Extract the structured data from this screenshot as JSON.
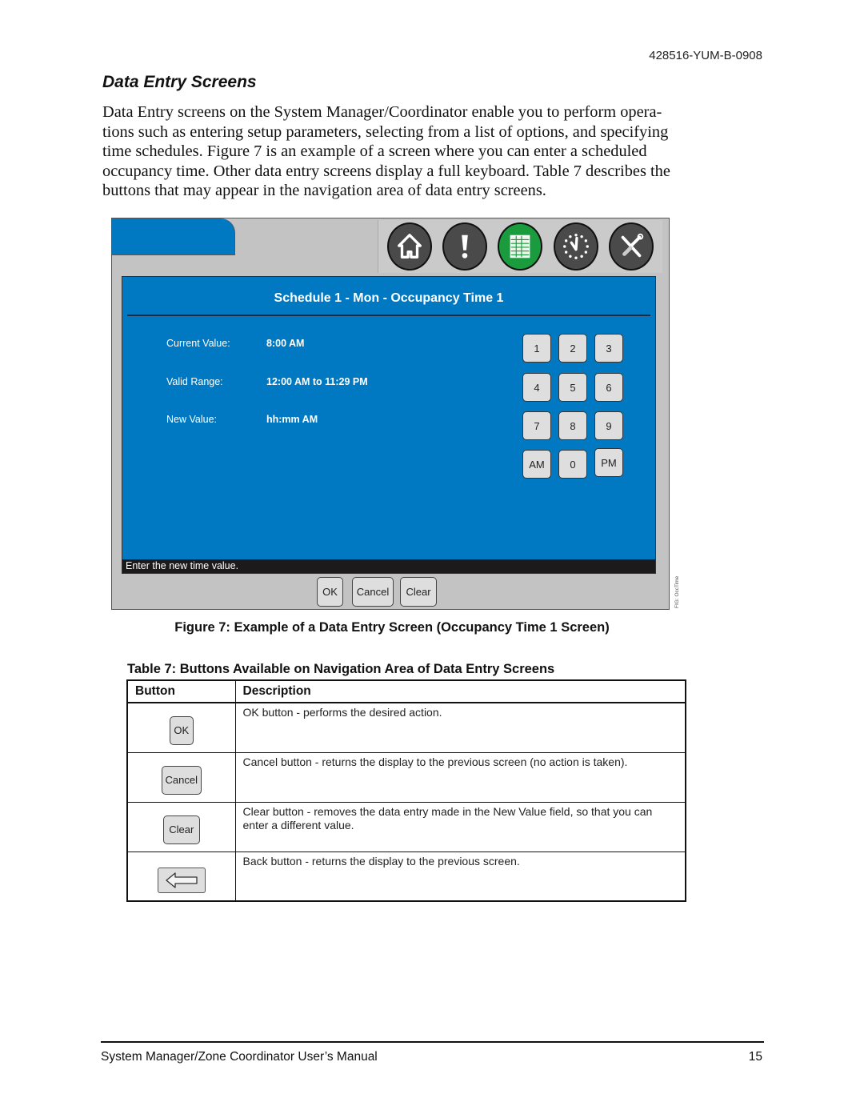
{
  "header": {
    "doc_id": "428516-YUM-B-0908"
  },
  "section": {
    "title": "Data Entry Screens",
    "body": "Data Entry screens on the System Manager/Coordinator enable you to perform opera-tions such as entering setup parameters, selecting from a list of options, and specifying time schedules. Figure 7 is an example of a screen where you can enter a scheduled occupancy time. Other data entry screens display a full keyboard. Table 7 describes the buttons that may appear in the navigation area of data entry screens."
  },
  "screen": {
    "nav_icons": [
      {
        "name": "home-icon",
        "active": false
      },
      {
        "name": "alarm-icon",
        "active": false
      },
      {
        "name": "schedule-icon",
        "active": true
      },
      {
        "name": "clock-icon",
        "active": false
      },
      {
        "name": "tools-icon",
        "active": false
      }
    ],
    "title": "Schedule 1 - Mon - Occupancy Time 1",
    "fields": [
      {
        "label": "Current Value:",
        "value": "8:00 AM"
      },
      {
        "label": "Valid Range:",
        "value": "12:00 AM to 11:29 PM"
      },
      {
        "label": "New Value:",
        "value": "hh:mm AM"
      }
    ],
    "keypad": [
      "1",
      "2",
      "3",
      "4",
      "5",
      "6",
      "7",
      "8",
      "9",
      "AM",
      "0",
      "PM"
    ],
    "status_message": "Enter the new time value.",
    "buttons": {
      "ok": "OK",
      "cancel": "Cancel",
      "clear": "Clear"
    },
    "fig_tag": "FIG: OccTime",
    "colors": {
      "panel": "#0079c2",
      "frame": "#c3c3c3",
      "active_icon": "#1a9c3e"
    }
  },
  "figure_caption": "Figure 7: Example of a Data Entry Screen (Occupancy Time 1 Screen)",
  "table": {
    "caption": "Table 7: Buttons Available on Navigation Area of Data Entry Screens",
    "headers": [
      "Button",
      "Description"
    ],
    "rows": [
      {
        "button": "OK",
        "description": "OK button - performs the desired action."
      },
      {
        "button": "Cancel",
        "description": "Cancel button - returns the display to the previous screen (no action is taken)."
      },
      {
        "button": "Clear",
        "description": "Clear button - removes the data entry made in the New Value field, so that you can enter a different value."
      },
      {
        "button": "back-arrow-icon",
        "description": "Back button - returns the display to the previous screen."
      }
    ]
  },
  "footer": {
    "title": "System Manager/Zone Coordinator User’s Manual",
    "page_number": "15"
  }
}
